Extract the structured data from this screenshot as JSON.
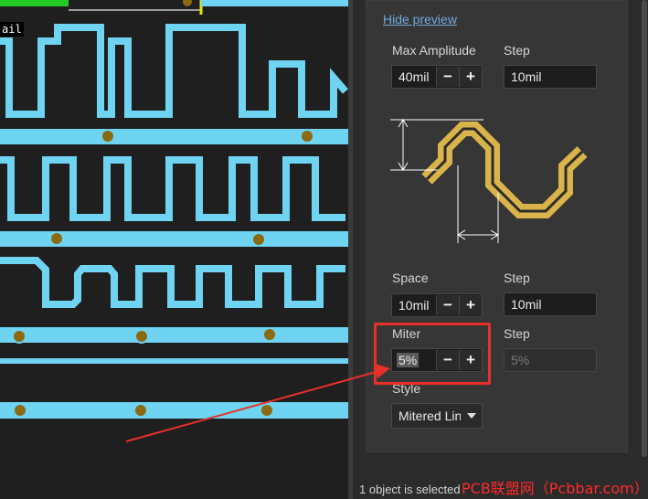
{
  "canvas": {
    "unit_label": "ail"
  },
  "panel": {
    "hide_preview": "Hide preview",
    "max_amplitude": {
      "label": "Max Amplitude",
      "value": "40mil",
      "step_label": "Step",
      "step_value": "10mil"
    },
    "space": {
      "label": "Space",
      "value": "10mil",
      "step_label": "Step",
      "step_value": "10mil"
    },
    "miter": {
      "label": "Miter",
      "value": "5%",
      "step_label": "Step",
      "step_value": "5%"
    },
    "style": {
      "label": "Style",
      "value": "Mitered Lines"
    },
    "minus_symbol": "−",
    "plus_symbol": "+"
  },
  "status": "1 object is selected",
  "watermark": "PCB联盟网（Pcbbar.com）",
  "colors": {
    "trace": "#6fd3f2",
    "via": "#8b6a12",
    "preview": "#d9b44a",
    "highlight": "#e8302a"
  }
}
